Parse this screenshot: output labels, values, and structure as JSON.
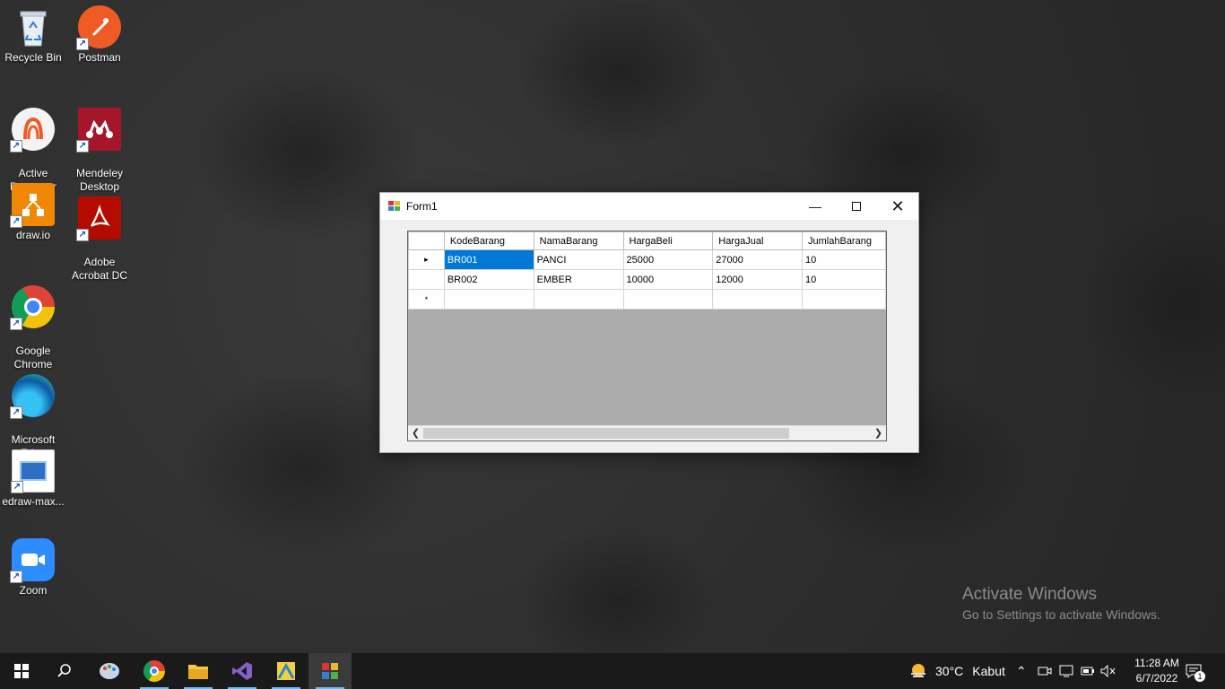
{
  "desktop": {
    "icons": [
      {
        "label": "Recycle Bin",
        "name": "recycle-bin-icon"
      },
      {
        "label": "Postman",
        "name": "postman-icon"
      },
      {
        "label": "Active\nPresenter",
        "name": "active-presenter-icon"
      },
      {
        "label": "Mendeley\nDesktop",
        "name": "mendeley-icon"
      },
      {
        "label": "draw.io",
        "name": "drawio-icon"
      },
      {
        "label": "Adobe\nAcrobat DC",
        "name": "acrobat-icon"
      },
      {
        "label": "Google\nChrome",
        "name": "chrome-icon"
      },
      {
        "label": "Microsoft\nEdge",
        "name": "edge-icon"
      },
      {
        "label": "edraw-max...",
        "name": "edraw-icon"
      },
      {
        "label": "Zoom",
        "name": "zoom-icon"
      }
    ]
  },
  "window": {
    "title": "Form1",
    "grid": {
      "columns": [
        "KodeBarang",
        "NamaBarang",
        "HargaBeli",
        "HargaJual",
        "JumlahBarang"
      ],
      "rows": [
        [
          "BR001",
          "PANCI",
          "25000",
          "27000",
          "10"
        ],
        [
          "BR002",
          "EMBER",
          "10000",
          "12000",
          "10"
        ]
      ],
      "current_row_marker": "▸",
      "new_row_marker": "*"
    }
  },
  "watermark": {
    "line1": "Activate Windows",
    "line2": "Go to Settings to activate Windows."
  },
  "taskbar": {
    "weather": {
      "temp": "30°C",
      "condition": "Kabut"
    },
    "clock": {
      "time": "11:28 AM",
      "date": "6/7/2022"
    },
    "notification_count": "1"
  }
}
